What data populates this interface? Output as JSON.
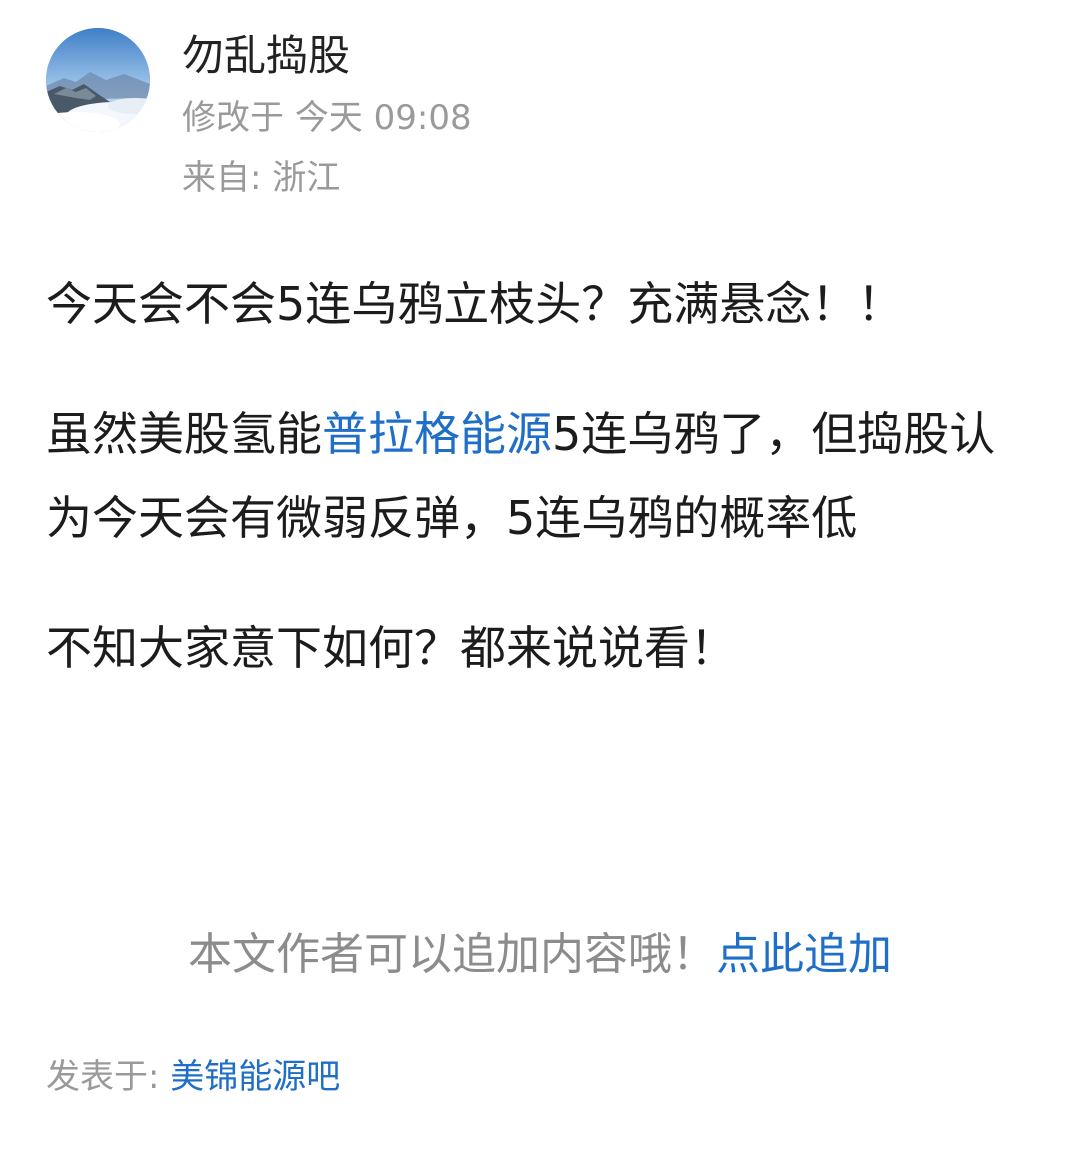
{
  "post": {
    "author": "勿乱捣股",
    "modified_label": "修改于",
    "modified_time": "今天 09:08",
    "location_label": "来自:",
    "location": "浙江",
    "paragraphs": {
      "p1": "今天会不会5连乌鸦立枝头？充满悬念！！",
      "p2_before": "虽然美股氢能",
      "p2_link": "普拉格能源",
      "p2_after": "5连乌鸦了，但捣股认为今天会有微弱反弹，5连乌鸦的概率低",
      "p3": "不知大家意下如何？都来说说看！"
    },
    "append_prompt": "本文作者可以追加内容哦！",
    "append_link": "点此追加",
    "posted_in_label": "发表于:",
    "forum": "美锦能源吧"
  },
  "colors": {
    "link": "#1f6fc8",
    "muted": "#9a9a9a",
    "text": "#1c1c1c"
  },
  "icons": {
    "avatar": "mountain-sea-of-clouds-avatar"
  }
}
